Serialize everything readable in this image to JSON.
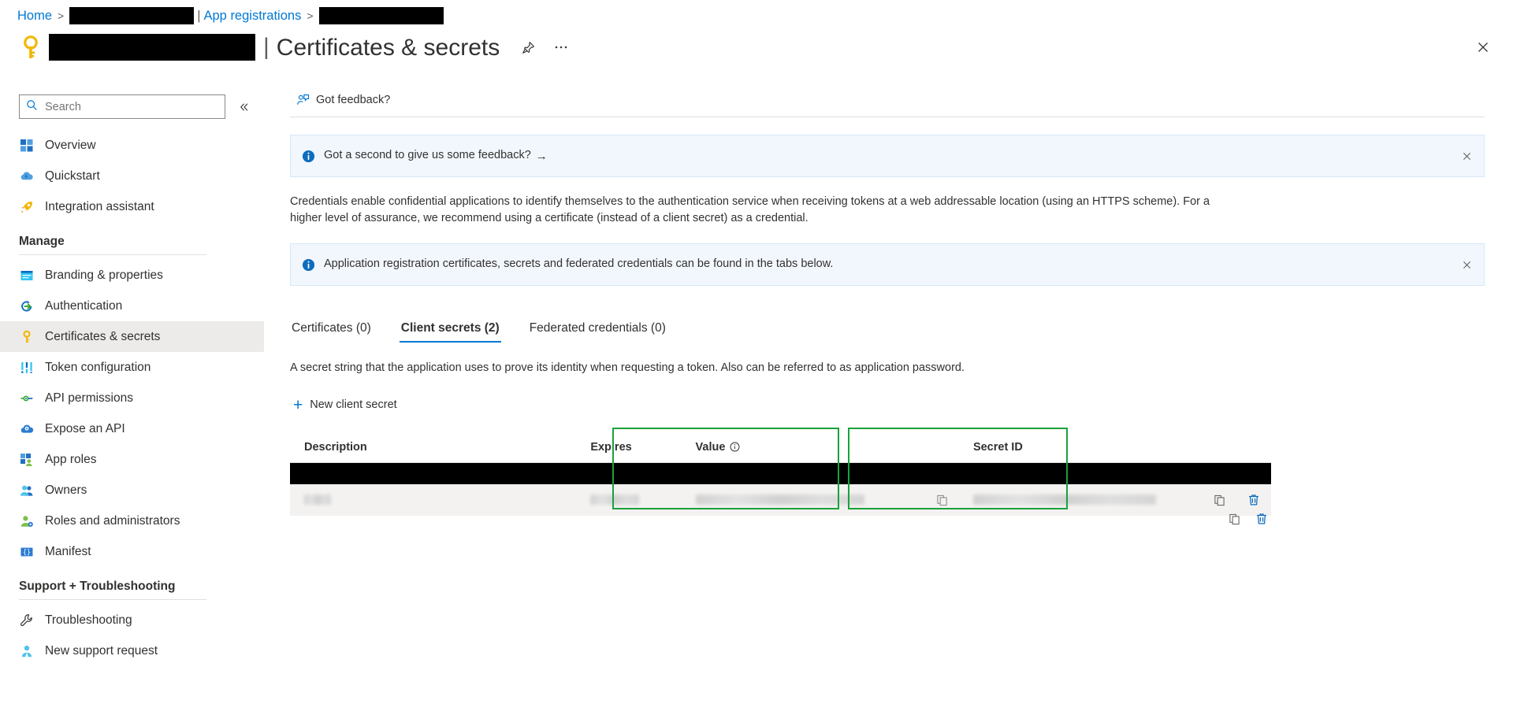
{
  "breadcrumb": {
    "home": "Home",
    "app_registrations": "App registrations",
    "separator": ">",
    "pipe": "|",
    "tenant_redacted": "",
    "app_redacted": ""
  },
  "header": {
    "icon": "key-icon",
    "app_name_redacted": "",
    "pipe": "|",
    "title": "Certificates & secrets",
    "pin_icon": "pin-icon",
    "more_icon": "ellipsis-icon",
    "close_icon": "close-icon"
  },
  "sidebar": {
    "search": {
      "placeholder": "Search",
      "value": "",
      "icon": "search-icon"
    },
    "collapse_icon": "chevron-double-left-icon",
    "items": [
      {
        "label": "Overview",
        "icon": "grid-icon",
        "selected": false
      },
      {
        "label": "Quickstart",
        "icon": "cloud-lightning-icon",
        "selected": false
      },
      {
        "label": "Integration assistant",
        "icon": "rocket-icon",
        "selected": false
      }
    ],
    "groups": [
      {
        "title": "Manage",
        "items": [
          {
            "label": "Branding & properties",
            "icon": "browser-icon",
            "selected": false
          },
          {
            "label": "Authentication",
            "icon": "arrow-circle-icon",
            "selected": false
          },
          {
            "label": "Certificates & secrets",
            "icon": "key-icon",
            "selected": true
          },
          {
            "label": "Token configuration",
            "icon": "sliders-icon",
            "selected": false
          },
          {
            "label": "API permissions",
            "icon": "plug-icon",
            "selected": false
          },
          {
            "label": "Expose an API",
            "icon": "cloud-gear-icon",
            "selected": false
          },
          {
            "label": "App roles",
            "icon": "grid-person-icon",
            "selected": false
          },
          {
            "label": "Owners",
            "icon": "people-icon",
            "selected": false
          },
          {
            "label": "Roles and administrators",
            "icon": "person-gear-icon",
            "selected": false
          },
          {
            "label": "Manifest",
            "icon": "braces-icon",
            "selected": false
          }
        ]
      },
      {
        "title": "Support + Troubleshooting",
        "items": [
          {
            "label": "Troubleshooting",
            "icon": "wrench-icon",
            "selected": false
          },
          {
            "label": "New support request",
            "icon": "person-icon",
            "selected": false
          }
        ]
      }
    ]
  },
  "commandbar": {
    "feedback": {
      "label": "Got feedback?",
      "icon": "feedback-person-icon"
    }
  },
  "banners": [
    {
      "icon": "info-icon",
      "text": "Got a second to give us some feedback?",
      "arrow": "→",
      "close_icon": "close-icon"
    },
    {
      "icon": "info-icon",
      "text": "Application registration certificates, secrets and federated credentials can be found in the tabs below.",
      "arrow": "",
      "close_icon": "close-icon"
    }
  ],
  "description": "Credentials enable confidential applications to identify themselves to the authentication service when receiving tokens at a web addressable location (using an HTTPS scheme). For a higher level of assurance, we recommend using a certificate (instead of a client secret) as a credential.",
  "tabs": [
    {
      "label": "Certificates (0)",
      "active": false
    },
    {
      "label": "Client secrets (2)",
      "active": true
    },
    {
      "label": "Federated credentials (0)",
      "active": false
    }
  ],
  "tab_description": "A secret string that the application uses to prove its identity when requesting a token. Also can be referred to as application password.",
  "new_secret_button": {
    "label": "New client secret",
    "icon": "plus-icon"
  },
  "table": {
    "columns": [
      {
        "label": "Description",
        "info_icon": false
      },
      {
        "label": "Expires",
        "info_icon": false
      },
      {
        "label": "Value",
        "info_icon": true
      },
      {
        "label": "Secret ID",
        "info_icon": false
      }
    ],
    "rows": [
      {
        "style": "redacted",
        "description": "",
        "expires": "",
        "value": "",
        "secret_id": "",
        "copy_icon": "copy-icon",
        "delete_icon": "trash-icon"
      },
      {
        "style": "blurred",
        "description": "",
        "expires": "",
        "value": "",
        "secret_id": "",
        "copy_icon": "copy-icon",
        "delete_icon": "trash-icon"
      }
    ]
  },
  "annotations": {
    "highlight_color": "#19a23b",
    "boxes": [
      {
        "name": "value-column-highlight"
      },
      {
        "name": "secret-id-column-highlight"
      }
    ]
  },
  "colors": {
    "accent": "#0078d4",
    "banner_bg": "#f2f7fd",
    "selected_nav": "#edebe9",
    "highlight_green": "#19a23b"
  }
}
